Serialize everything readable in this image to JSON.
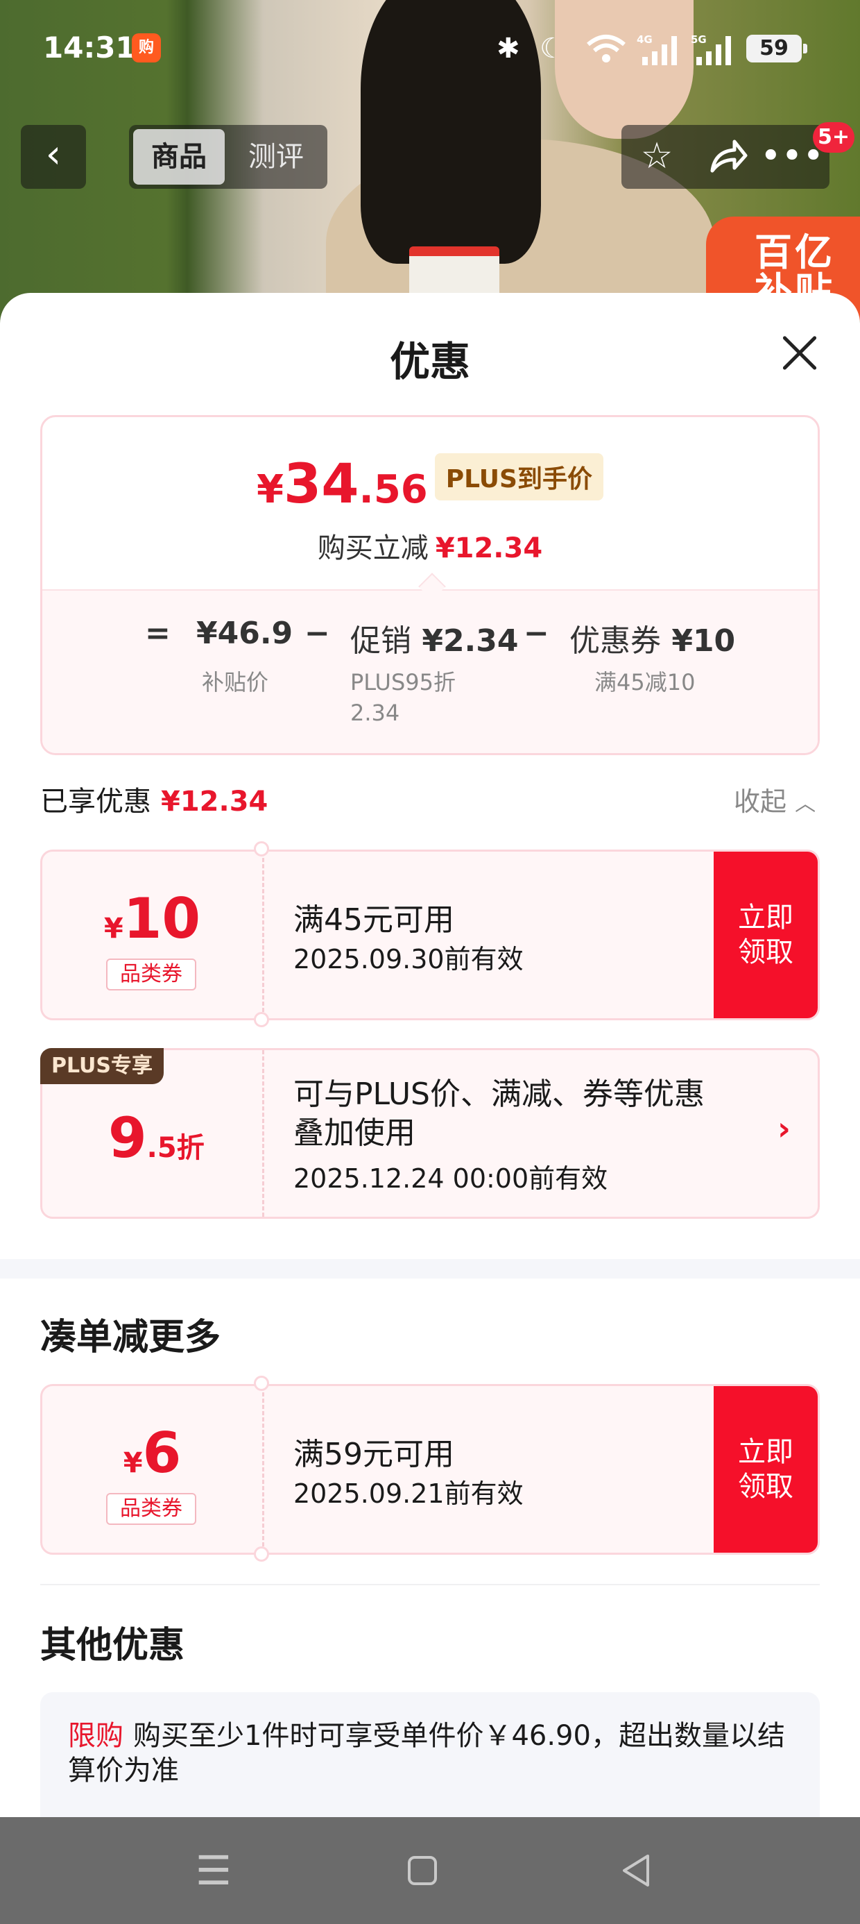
{
  "status_bar": {
    "time": "14:31",
    "app_icon_text": "购",
    "battery": "59",
    "icons": [
      "bluetooth-icon",
      "moon-icon",
      "wifi-icon",
      "signal-4g-icon",
      "signal-5g-icon"
    ]
  },
  "background": {
    "badge_text": "百亿补贴"
  },
  "top_nav": {
    "back_glyph": "‹",
    "tabs": [
      "商品",
      "测评"
    ],
    "notification_count": "5+"
  },
  "sheet": {
    "title": "优惠",
    "price": {
      "currency": "¥",
      "integer": "34",
      "decimal": ".56",
      "plus_tag": "PLUS到手价",
      "reduce_label": "购买立减",
      "reduce_value": "¥12.34"
    },
    "breakdown": {
      "eq": "=",
      "subsidy_price": "¥46.9",
      "subsidy_label": "补贴价",
      "minus1": "−",
      "promo_label": "促销",
      "promo_value": "¥2.34",
      "promo_sub": "PLUS95折",
      "promo_sub2": "2.34",
      "minus2": "−",
      "coupon_label": "优惠券",
      "coupon_value": "¥10",
      "coupon_sub": "满45减10"
    },
    "enjoyed": {
      "label": "已享优惠",
      "value": "¥12.34",
      "collapse": "收起"
    },
    "coupons": [
      {
        "currency": "¥",
        "amount": "10",
        "category": "品类券",
        "condition": "满45元可用",
        "validity": "2025.09.30前有效",
        "action": "立即领取"
      }
    ],
    "plus_discount": {
      "badge": "PLUS专享",
      "rate_big": "9",
      "rate_small": ".5折",
      "description": "可与PLUS价、满减、券等优惠叠加使用",
      "validity": "2025.12.24 00:00前有效"
    },
    "more_section": {
      "title": "凑单减更多",
      "coupon": {
        "currency": "¥",
        "amount": "6",
        "category": "品类券",
        "condition": "满59元可用",
        "validity": "2025.09.21前有效",
        "action": "立即领取"
      }
    },
    "other_section": {
      "title": "其他优惠",
      "tag": "限购",
      "text": "购买至少1件时可享受单件价￥46.90，超出数量以结算价为准"
    }
  },
  "colors": {
    "accent_red": "#e8162c",
    "button_red": "#f5102a",
    "plus_gold": "#8a4b05"
  }
}
